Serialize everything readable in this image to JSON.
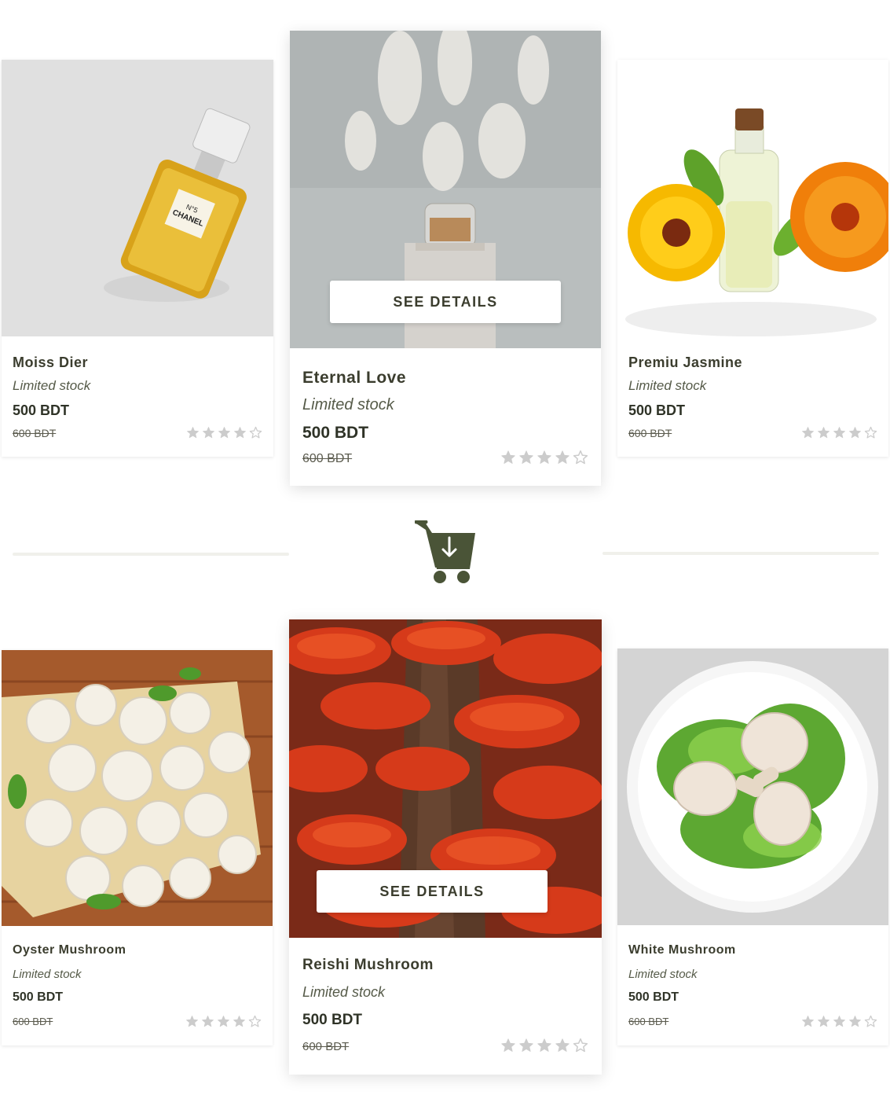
{
  "colors": {
    "accent": "#4a5437",
    "star": "#cccccc",
    "divider": "#f0f0eb"
  },
  "divider_icon": "cart-download-icon",
  "products": [
    {
      "name": "Moiss Dier",
      "stock": "Limited stock",
      "price": "500 BDT",
      "old_price": "600 BDT",
      "rating": 4,
      "image": "perfume-chanel-image"
    },
    {
      "name": "Eternal Love",
      "stock": "Limited stock",
      "price": "500 BDT",
      "old_price": "600 BDT",
      "rating": 4,
      "image": "perfume-cartier-image",
      "button": "SEE DETAILS"
    },
    {
      "name": "Premiu Jasmine",
      "stock": "Limited stock",
      "price": "500 BDT",
      "old_price": "600 BDT",
      "rating": 4,
      "image": "jasmine-oil-image"
    },
    {
      "name": "Oyster Mushroom",
      "stock": "Limited stock",
      "price": "500 BDT",
      "old_price": "600 BDT",
      "rating": 4,
      "image": "mushroom-basket-image"
    },
    {
      "name": "Reishi Mushroom",
      "stock": "Limited stock",
      "price": "500 BDT",
      "old_price": "600 BDT",
      "rating": 4,
      "image": "reishi-mushroom-image",
      "button": "SEE DETAILS"
    },
    {
      "name": "White Mushroom",
      "stock": "Limited stock",
      "price": "500 BDT",
      "old_price": "600 BDT",
      "rating": 4,
      "image": "mushroom-plate-image"
    }
  ]
}
